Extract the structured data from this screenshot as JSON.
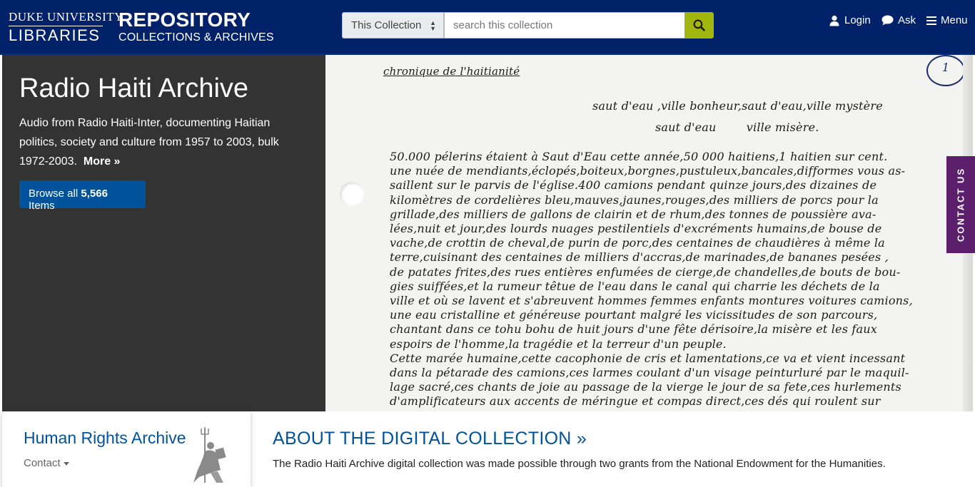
{
  "header": {
    "logo_top": "DUKE UNIVERSITY",
    "logo_bottom": "LIBRARIES",
    "repo_title": "REPOSITORY",
    "repo_subtitle": "COLLECTIONS & ARCHIVES",
    "search_scope": "This Collection",
    "search_placeholder": "search this collection",
    "nav": {
      "login": "Login",
      "ask": "Ask",
      "menu": "Menu"
    },
    "bg_color": "#012169",
    "search_button_color": "#a1b70d"
  },
  "hero": {
    "title": "Radio Haiti Archive",
    "description": "Audio from Radio Haiti-Inter, documenting Haitian politics, society and culture from 1957 to 2003, bulk 1972-2003.",
    "more_link": "More »",
    "browse_prefix": "Browse all",
    "browse_count": "5,566",
    "browse_suffix": "Items",
    "image": {
      "heading": "chronique de l'haitianité",
      "page_mark": "1",
      "lines": [
        "saut d'eau ,ville bonheur,saut d'eau,ville mystère",
        "saut d'eau        ville misère.",
        "50.000 pélerins étaient à Saut d'Eau cette année,50 000 haitiens,1 haitien sur cent.",
        "une nuée de mendiants,éclopés,boiteux,borgnes,pustuleux,bancales,difformes vous as-",
        "saillent sur le parvis de l'église.400 camions pendant quinze jours,des dizaines de",
        "kilomètres de cordelières bleu,mauves,jaunes,rouges,des milliers de porcs pour la",
        "grillade,des milliers de gallons de clairin et de rhum,des tonnes de poussière ava-",
        "lées,nuit et jour,des lourds nuages pestilentiels d'excréments humains,de bouse de",
        "vache,de crottin de cheval,de purin de porc,des centaines de chaudières à même la",
        "terre,cuisinant des centaines de milliers d'accras,de marinades,de bananes pesées ,",
        "de patates frites,des rues entières enfumées de cierge,de chandelles,de bouts de bou-",
        "gies suiffées,et la rumeur têtue de l'eau dans le canal qui charrie les déchets de la",
        "ville et où se lavent et s'abreuvent hommes femmes enfants montures voitures camions,",
        "une eau cristalline et généreuse pourtant malgré les vicissitudes de son parcours,",
        "chantant dans ce tohu bohu de huit jours d'une fête dérisoire,la misère et les faux",
        "espoirs de l'homme,la tragédie et la terreur d'un peuple.",
        "Cette marée humaine,cette cacophonie de cris et lamentations,ce va et vient incessant",
        "dans la pétarade des camions,ces larmes coulant d'un visage peinturluré par le maquil-",
        "lage sacré,ces chants de joie au passage de la vierge le jour de sa fete,ces hurlements",
        "d'amplificateurs aux accents de méringue et compas direct,ces dés qui roulent sur"
      ]
    }
  },
  "contact_tab": "CONTACT US",
  "sidebar_card": {
    "title": "Human Rights Archive",
    "contact": "Contact"
  },
  "about": {
    "title": "ABOUT THE DIGITAL COLLECTION »",
    "text": "The Radio Haiti Archive digital collection was made possible through two grants from the National Endowment for the Humanities."
  }
}
